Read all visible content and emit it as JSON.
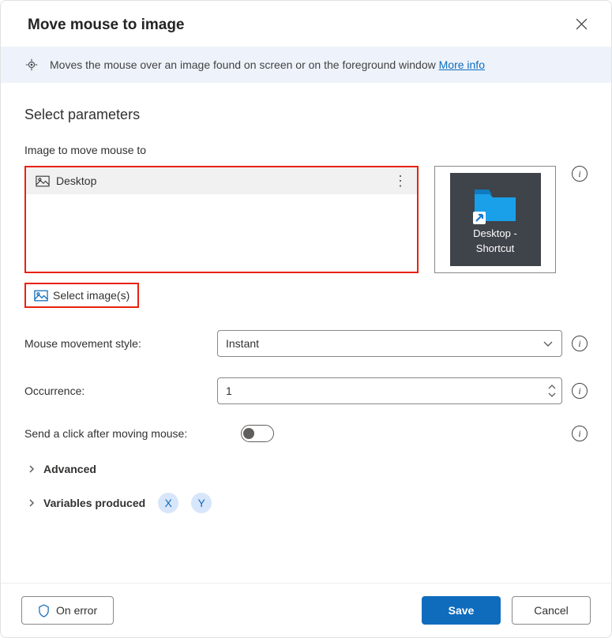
{
  "header": {
    "title": "Move mouse to image"
  },
  "banner": {
    "text": "Moves the mouse over an image found on screen or on the foreground window ",
    "link": "More info"
  },
  "section_title": "Select parameters",
  "image_field_label": "Image to move mouse to",
  "image_list": {
    "items": [
      {
        "name": "Desktop"
      }
    ]
  },
  "preview": {
    "line1": "Desktop -",
    "line2": "Shortcut"
  },
  "select_images_label": "Select image(s)",
  "fields": {
    "movement_style": {
      "label": "Mouse movement style:",
      "value": "Instant"
    },
    "occurrence": {
      "label": "Occurrence:",
      "value": "1"
    },
    "send_click": {
      "label": "Send a click after moving mouse:",
      "value": false
    }
  },
  "advanced_label": "Advanced",
  "variables": {
    "label": "Variables produced",
    "chips": [
      "X",
      "Y"
    ]
  },
  "footer": {
    "on_error": "On error",
    "save": "Save",
    "cancel": "Cancel"
  }
}
